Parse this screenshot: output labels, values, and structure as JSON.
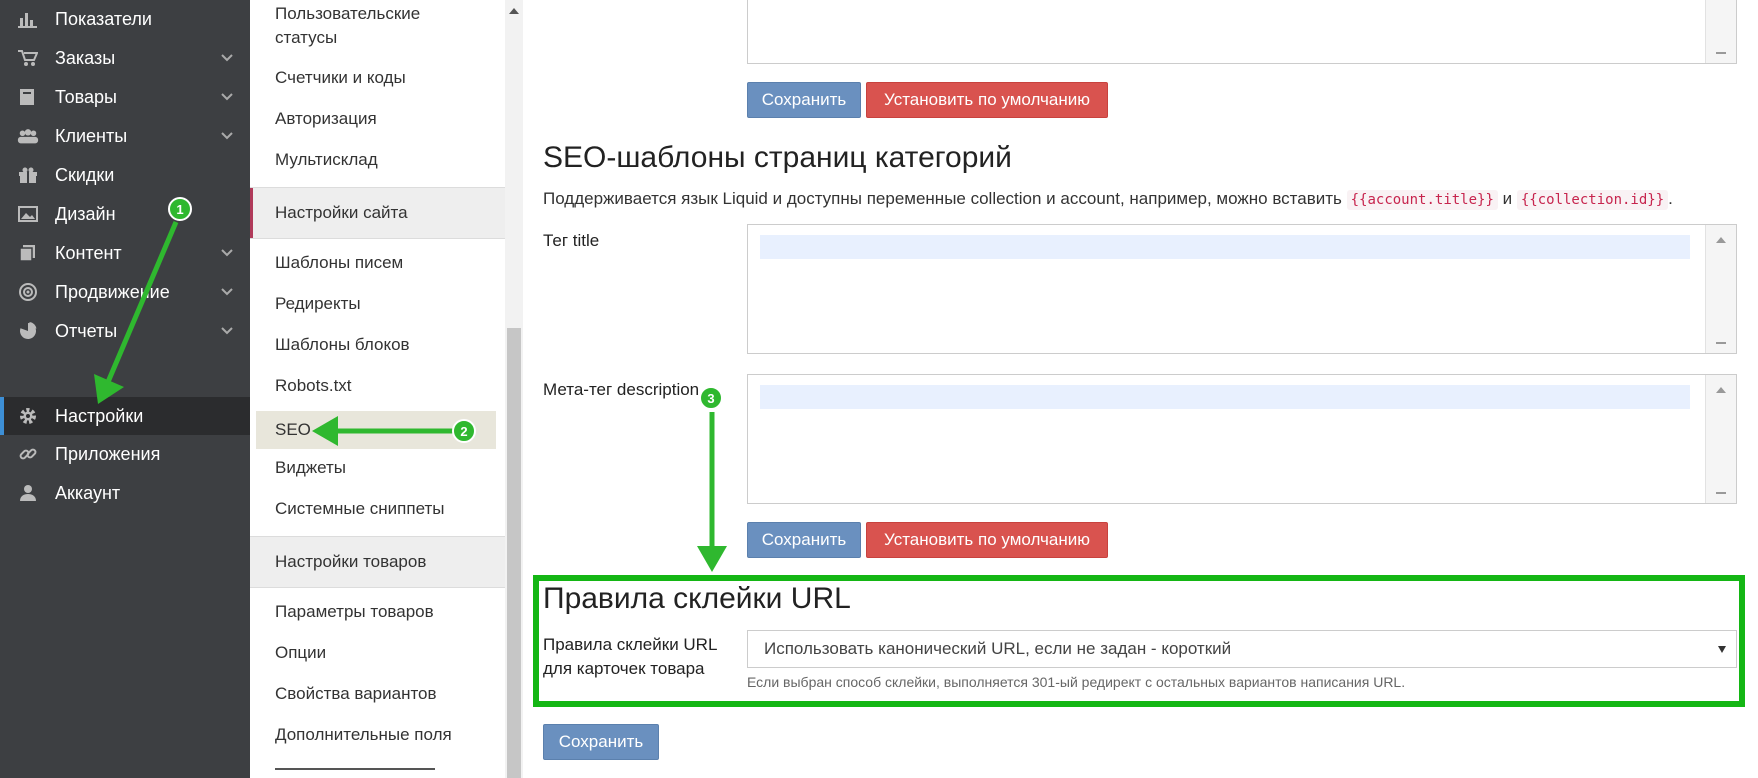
{
  "sidebar": {
    "items": [
      {
        "label": "Показатели",
        "icon": "chart-icon",
        "has_chevron": false
      },
      {
        "label": "Заказы",
        "icon": "cart-icon",
        "has_chevron": true
      },
      {
        "label": "Товары",
        "icon": "book-icon",
        "has_chevron": true
      },
      {
        "label": "Клиенты",
        "icon": "users-icon",
        "has_chevron": true
      },
      {
        "label": "Скидки",
        "icon": "gift-icon",
        "has_chevron": false
      },
      {
        "label": "Дизайн",
        "icon": "image-icon",
        "has_chevron": false
      },
      {
        "label": "Контент",
        "icon": "copy-icon",
        "has_chevron": true
      },
      {
        "label": "Продвижение",
        "icon": "target-icon",
        "has_chevron": true
      },
      {
        "label": "Отчеты",
        "icon": "pie-icon",
        "has_chevron": true
      },
      {
        "label": "Настройки",
        "icon": "gear-icon",
        "has_chevron": false,
        "active": true
      },
      {
        "label": "Приложения",
        "icon": "link-icon",
        "has_chevron": false
      },
      {
        "label": "Аккаунт",
        "icon": "user-icon",
        "has_chevron": false
      }
    ]
  },
  "submenu": {
    "items_top": [
      "Пользовательские",
      "статусы",
      "Счетчики и коды",
      "Авторизация",
      "Мультисклад"
    ],
    "header_site": "Настройки сайта",
    "items_site": [
      "Шаблоны писем",
      "Редиректы",
      "Шаблоны блоков",
      "Robots.txt",
      "SEO",
      "Виджеты",
      "Системные сниппеты"
    ],
    "header_products": "Настройки товаров",
    "items_products": [
      "Параметры товаров",
      "Опции",
      "Свойства вариантов",
      "Дополнительные поля"
    ]
  },
  "main": {
    "buttons": {
      "save": "Сохранить",
      "reset": "Установить по умолчанию"
    },
    "seo_section": {
      "title": "SEO-шаблоны страниц категорий",
      "desc_before": "Поддерживается язык Liquid и доступны переменные collection и account, например, можно вставить ",
      "var1": "{{account.title}}",
      "desc_middle": " и ",
      "var2": "{{collection.id}}",
      "desc_after": ".",
      "label_title": "Тег title",
      "label_description": "Мета-тег description"
    },
    "url_section": {
      "title": "Правила склейки URL",
      "label_line1": "Правила склейки URL",
      "label_line2": "для карточек товара",
      "select_value": "Использовать канонический URL, если не задан - короткий",
      "hint": "Если выбран способ склейки, выполняется 301-ый редирект с остальных вариантов написания URL."
    }
  },
  "annotations": {
    "badges": [
      "1",
      "2",
      "3"
    ],
    "colors": {
      "arrow": "#2fb82f",
      "box": "#14b614"
    }
  }
}
